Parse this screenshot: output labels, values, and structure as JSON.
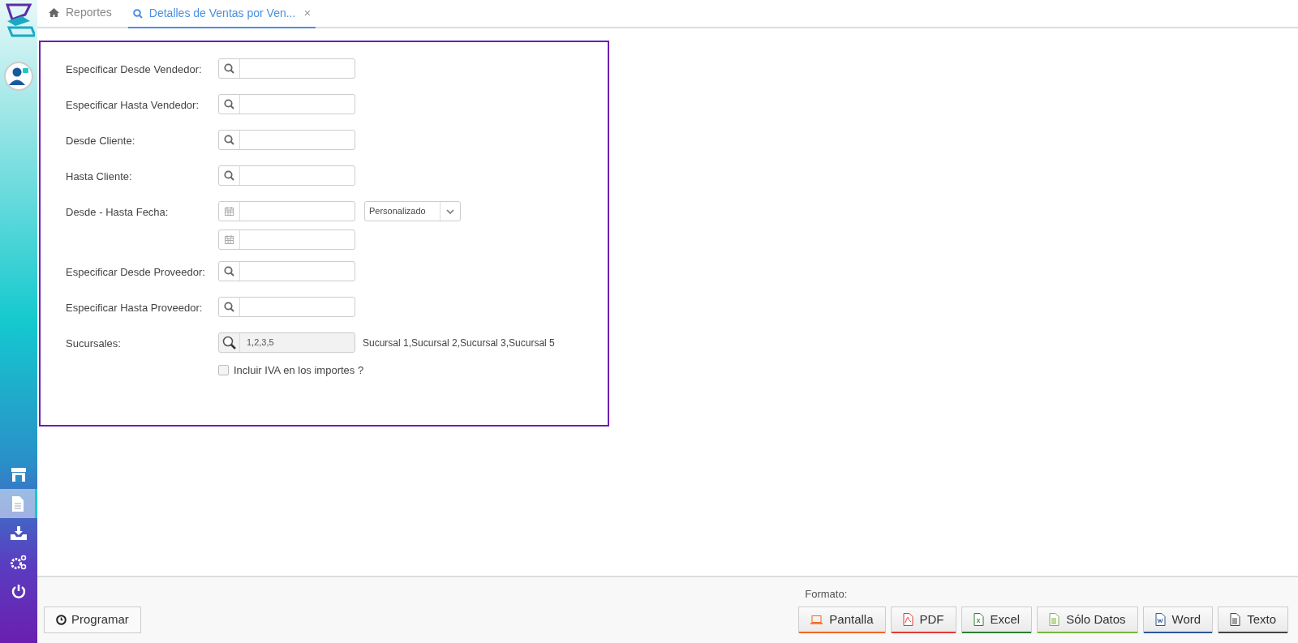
{
  "sidebar": {
    "items": [
      {
        "kind": "store",
        "selected": false
      },
      {
        "kind": "document",
        "selected": true
      },
      {
        "kind": "download",
        "selected": false
      },
      {
        "kind": "gears",
        "selected": false
      },
      {
        "kind": "power",
        "selected": false
      }
    ]
  },
  "tabs": [
    {
      "kind": "home",
      "label": "Reportes",
      "selected": false,
      "closable": false
    },
    {
      "kind": "search",
      "label": "Detalles de Ventas por Ven...",
      "selected": true,
      "closable": true,
      "close": "×"
    }
  ],
  "form": {
    "rows": [
      {
        "kind": "search",
        "label": "Especificar Desde Vendedor:"
      },
      {
        "kind": "search",
        "label": "Especificar Hasta Vendedor:"
      },
      {
        "kind": "search",
        "label": "Desde Cliente:"
      },
      {
        "kind": "search",
        "label": "Hasta Cliente:"
      },
      {
        "kind": "daterange",
        "label": "Desde - Hasta Fecha:",
        "preset": "Personalizado"
      },
      {
        "kind": "search",
        "label": "Especificar Desde Proveedor:"
      },
      {
        "kind": "search",
        "label": "Especificar Hasta Proveedor:"
      },
      {
        "kind": "branches",
        "label": "Sucursales:",
        "value": "1,2,3,5",
        "description": "Sucursal 1,Sucursal 2,Sucursal 3,Sucursal 5"
      },
      {
        "kind": "checkbox",
        "label": "Incluir IVA en los importes ?",
        "checked": false
      }
    ]
  },
  "footer": {
    "schedule_button": "Programar",
    "format_label": "Formato:",
    "format_buttons": [
      {
        "kind": "screen",
        "label": "Pantalla",
        "color": "#f26522"
      },
      {
        "kind": "pdf",
        "label": "PDF",
        "color": "#e53935"
      },
      {
        "kind": "excel",
        "label": "Excel",
        "color": "#2e7d32"
      },
      {
        "kind": "data",
        "label": "Sólo Datos",
        "color": "#7cb342"
      },
      {
        "kind": "word",
        "label": "Word",
        "color": "#2b579a"
      },
      {
        "kind": "text",
        "label": "Texto",
        "color": "#444444"
      }
    ]
  }
}
